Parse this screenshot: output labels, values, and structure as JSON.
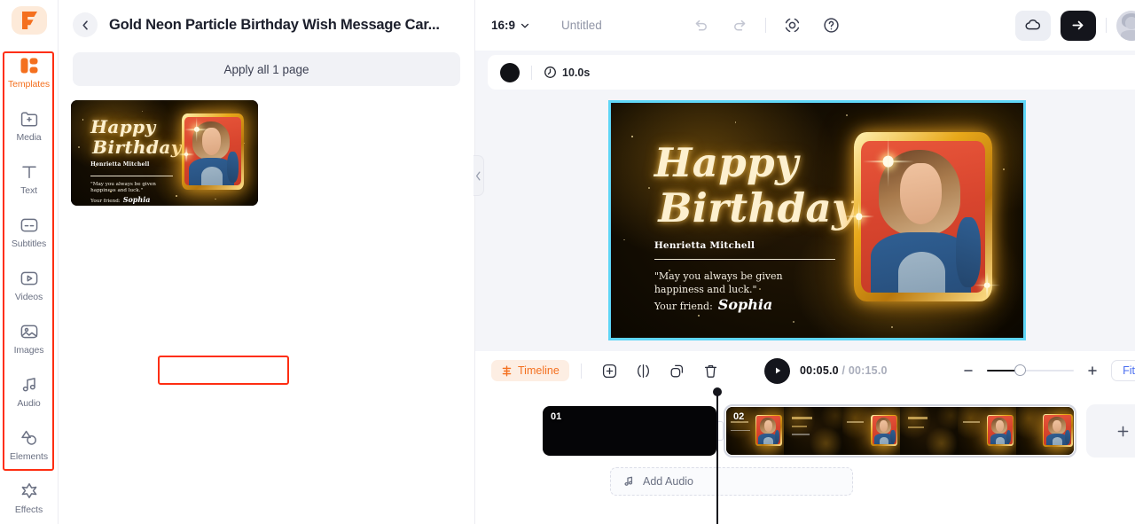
{
  "brand": {
    "logo_letter": "F",
    "logo_bg": "#fdead9",
    "accent": "#f4701f"
  },
  "sidebar": {
    "items": [
      {
        "label": "Templates",
        "icon": "templates-icon",
        "active": true
      },
      {
        "label": "Media",
        "icon": "media-folder-plus-icon",
        "active": false
      },
      {
        "label": "Text",
        "icon": "text-t-icon",
        "active": false
      },
      {
        "label": "Subtitles",
        "icon": "subtitles-icon",
        "active": false
      },
      {
        "label": "Videos",
        "icon": "video-play-icon",
        "active": false
      },
      {
        "label": "Images",
        "icon": "image-icon",
        "active": false
      },
      {
        "label": "Audio",
        "icon": "music-note-icon",
        "active": false
      },
      {
        "label": "Elements",
        "icon": "shapes-icon",
        "active": false
      },
      {
        "label": "Effects",
        "icon": "sparkle-star-icon",
        "active": false
      }
    ]
  },
  "panel": {
    "back_icon": "chevron-left-icon",
    "title": "Gold Neon Particle Birthday Wish Message Car...",
    "apply_all_label": "Apply all 1 page",
    "collapse_icon": "chevron-left-icon"
  },
  "card": {
    "line1": "Happy",
    "line2": "Birthday",
    "name": "Henrietta Mitchell",
    "quote_line1": "\"May you always be given",
    "quote_line2": "happiness and luck.\"",
    "signoff": "Your friend:",
    "signature": "Sophia"
  },
  "topbar": {
    "ratio": "16:9",
    "ratio_caret": "chevron-down-icon",
    "project_name": "Untitled",
    "undo_icon": "undo-arrow-icon",
    "redo_icon": "redo-arrow-icon",
    "record_icon": "screen-record-icon",
    "help_icon": "question-mark-icon",
    "cloud_icon": "cloud-save-icon",
    "export_icon": "arrow-right-icon",
    "avatar_icon": "user-avatar"
  },
  "subbar": {
    "color_swatch": "#111216",
    "clock_icon": "clock-icon",
    "duration": "10.0s"
  },
  "canvas": {
    "border_color": "#5fd6f7",
    "magic_icon": "magic-sparkle-icon",
    "magic_color": "#c11ad4"
  },
  "timeline": {
    "tab_label": "Timeline",
    "tab_icon": "timeline-icon",
    "tools": [
      {
        "label": "Add",
        "icon": "plus-square-icon"
      },
      {
        "label": "Split",
        "icon": "split-icon"
      },
      {
        "label": "Duplicate",
        "icon": "duplicate-icon"
      },
      {
        "label": "Delete",
        "icon": "trash-icon"
      }
    ],
    "play_icon": "play-icon",
    "current_time": "00:05.0",
    "time_separator": " / ",
    "total_time": "00:15.0",
    "zoom_out_icon": "minus-icon",
    "zoom_in_icon": "plus-icon",
    "zoom_percent": 38,
    "fit_label": "Fit",
    "clips": [
      {
        "number": "01",
        "selected": false
      },
      {
        "number": "02",
        "selected": true
      }
    ],
    "add_clip_icon": "plus-icon",
    "add_audio_label": "Add Audio",
    "add_audio_icon": "music-note-icon"
  },
  "annotations": [
    {
      "name": "sidebar-highlight",
      "color": "#fe2e12"
    },
    {
      "name": "timeline-tools-highlight",
      "color": "#fe2e12"
    }
  ]
}
